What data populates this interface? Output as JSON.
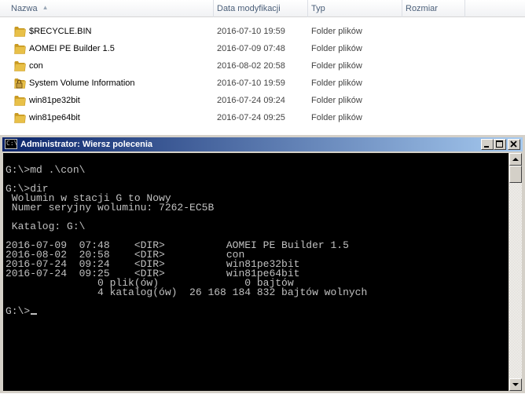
{
  "explorer": {
    "columns": {
      "name": "Nazwa",
      "modified": "Data modyfikacji",
      "type": "Typ",
      "size": "Rozmiar"
    },
    "files": [
      {
        "name": "$RECYCLE.BIN",
        "modified": "2016-07-10 19:59",
        "type": "Folder plików",
        "icon": "folder-icon"
      },
      {
        "name": "AOMEI PE Builder 1.5",
        "modified": "2016-07-09 07:48",
        "type": "Folder plików",
        "icon": "folder-icon"
      },
      {
        "name": "con",
        "modified": "2016-08-02 20:58",
        "type": "Folder plików",
        "icon": "folder-icon"
      },
      {
        "name": "System Volume Information",
        "modified": "2016-07-10 19:59",
        "type": "Folder plików",
        "icon": "locked-folder-icon"
      },
      {
        "name": "win81pe32bit",
        "modified": "2016-07-24 09:24",
        "type": "Folder plików",
        "icon": "folder-icon"
      },
      {
        "name": "win81pe64bit",
        "modified": "2016-07-24 09:25",
        "type": "Folder plików",
        "icon": "folder-icon"
      }
    ]
  },
  "console": {
    "title": "Administrator: Wiersz polecenia",
    "icon_text": "C:\\",
    "lines": [
      "",
      "G:\\>md .\\con\\",
      "",
      "G:\\>dir",
      " Wolumin w stacji G to Nowy",
      " Numer seryjny woluminu: 7262-EC5B",
      "",
      " Katalog: G:\\",
      "",
      "2016-07-09  07:48    <DIR>          AOMEI PE Builder 1.5",
      "2016-08-02  20:58    <DIR>          con",
      "2016-07-24  09:24    <DIR>          win81pe32bit",
      "2016-07-24  09:25    <DIR>          win81pe64bit",
      "               0 plik(ów)              0 bajtów",
      "               4 katalog(ów)  26 168 184 832 bajtów wolnych",
      "",
      "G:\\>"
    ]
  },
  "colors": {
    "folder": "#e8c048",
    "folder_dark": "#c99a22",
    "titlebar_start": "#0a246a",
    "titlebar_end": "#a6caf0",
    "console_text": "#c0c0c0"
  }
}
